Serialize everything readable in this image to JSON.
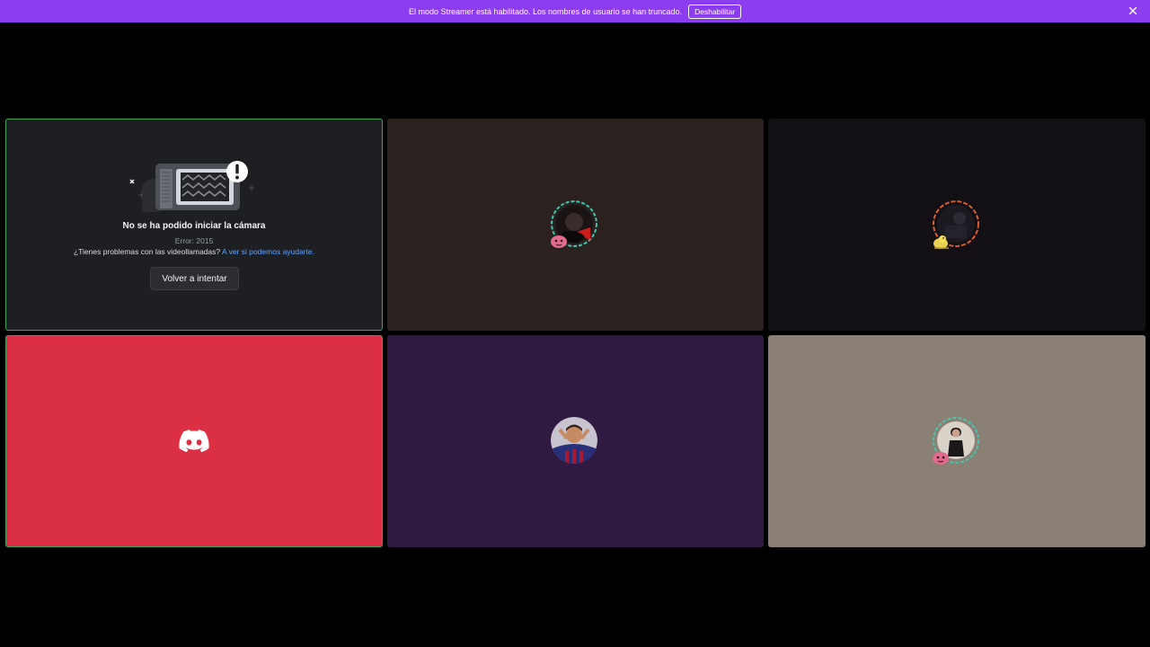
{
  "banner": {
    "message": "El modo Streamer está habilitado. Los nombres de usuario se han truncado.",
    "button_label": "Deshabilitar",
    "close_icon": "close-icon",
    "color": "#8d3df0"
  },
  "tiles": [
    {
      "id": "self-camera",
      "error": {
        "title": "No se ha podido iniciar la cámara",
        "code": "Error: 2015",
        "help_text": "¿Tienes problemas con las videollamadas?",
        "help_link": "A ver si podemos ayudarte.",
        "retry_label": "Volver a intentar",
        "illustration": "broken-camera-illustration"
      },
      "background": "#1e1f22",
      "speaking_border": "#3ba55d"
    },
    {
      "id": "participant-2",
      "background": "#2b2220",
      "avatar_ring": "#43c8b0"
    },
    {
      "id": "participant-3",
      "background": "#120f15",
      "avatar_ring": "#e0612c"
    },
    {
      "id": "participant-4",
      "background": "#db3044",
      "icon": "discord-logo-icon"
    },
    {
      "id": "participant-5",
      "background": "#2f1a42"
    },
    {
      "id": "participant-6",
      "background": "#8a8075",
      "avatar_ring": "#43c8b0"
    }
  ]
}
